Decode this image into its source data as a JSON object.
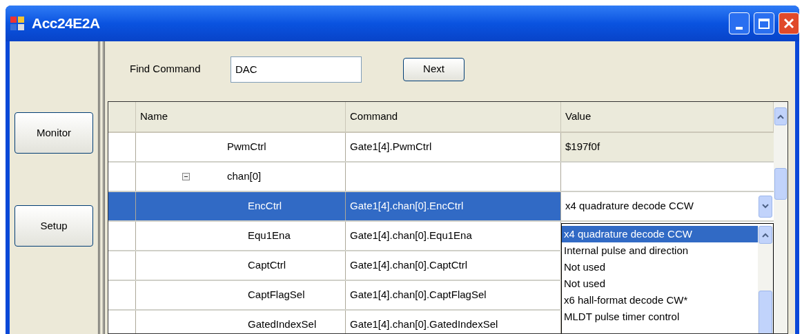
{
  "window": {
    "title": "Acc24E2A"
  },
  "sidebar": {
    "buttons": [
      {
        "label": "Monitor"
      },
      {
        "label": "Setup"
      }
    ]
  },
  "find": {
    "label": "Find Command",
    "value": "DAC",
    "button": "Next"
  },
  "grid": {
    "columns": [
      "Name",
      "Command",
      "Value"
    ],
    "rows": [
      {
        "name": "PwmCtrl",
        "command": "Gate1[4].PwmCtrl",
        "value": "$197f0f",
        "selected": false
      },
      {
        "name": "chan[0]",
        "expanded": true,
        "selected": false,
        "children": [
          {
            "name": "EncCtrl",
            "command": "Gate1[4].chan[0].EncCtrl",
            "selected": true,
            "editor": {
              "value": "x4 quadrature decode CCW",
              "options": [
                {
                  "label": "x4 quadrature decode CCW",
                  "selected": true
                },
                {
                  "label": "Internal pulse and direction",
                  "selected": false
                },
                {
                  "label": "Not used",
                  "selected": false
                },
                {
                  "label": "Not used",
                  "selected": false
                },
                {
                  "label": "x6 hall-format decode CW*",
                  "selected": false
                },
                {
                  "label": "MLDT pulse timer control",
                  "selected": false
                }
              ]
            }
          },
          {
            "name": "Equ1Ena",
            "command": "Gate1[4].chan[0].Equ1Ena",
            "selected": false
          },
          {
            "name": "CaptCtrl",
            "command": "Gate1[4].chan[0].CaptCtrl",
            "selected": false
          },
          {
            "name": "CaptFlagSel",
            "command": "Gate1[4].chan[0].CaptFlagSel",
            "selected": false
          },
          {
            "name": "GatedIndexSel",
            "command": "Gate1[4].chan[0].GatedIndexSel",
            "selected": false
          }
        ]
      }
    ]
  }
}
